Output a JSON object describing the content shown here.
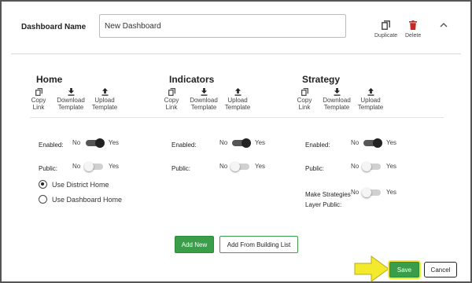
{
  "dashboard": {
    "name_label": "Dashboard Name",
    "name_value": "New Dashboard",
    "duplicate_label": "Duplicate",
    "delete_label": "Delete",
    "collapse_icon": "chevron-up-icon"
  },
  "tool_labels": {
    "copy_1": "Copy",
    "copy_2": "Link",
    "download_1": "Download",
    "download_2": "Template",
    "upload_1": "Upload",
    "upload_2": "Template"
  },
  "sections": [
    {
      "title": "Home",
      "enabled_label": "Enabled:",
      "public_label": "Public:",
      "enabled": true,
      "public": false
    },
    {
      "title": "Indicators",
      "enabled_label": "Enabled:",
      "public_label": "Public:",
      "enabled": true,
      "public": false
    },
    {
      "title": "Strategy",
      "enabled_label": "Enabled:",
      "public_label": "Public:",
      "layer_public_label_1": "Make Strategies",
      "layer_public_label_2": "Layer Public:",
      "enabled": true,
      "public": false,
      "layer_public": false
    }
  ],
  "toggle_text": {
    "no": "No",
    "yes": "Yes"
  },
  "home_options": {
    "use_district_home": "Use District Home",
    "use_dashboard_home": "Use Dashboard Home",
    "selected": "Use District Home"
  },
  "actions": {
    "add_new": "Add New",
    "add_from_building_list": "Add From Building List",
    "save": "Save",
    "cancel": "Cancel"
  },
  "colors": {
    "accent_green": "#3a9d4a",
    "highlight_yellow": "#f3ea2e",
    "delete_red": "#c62828"
  }
}
